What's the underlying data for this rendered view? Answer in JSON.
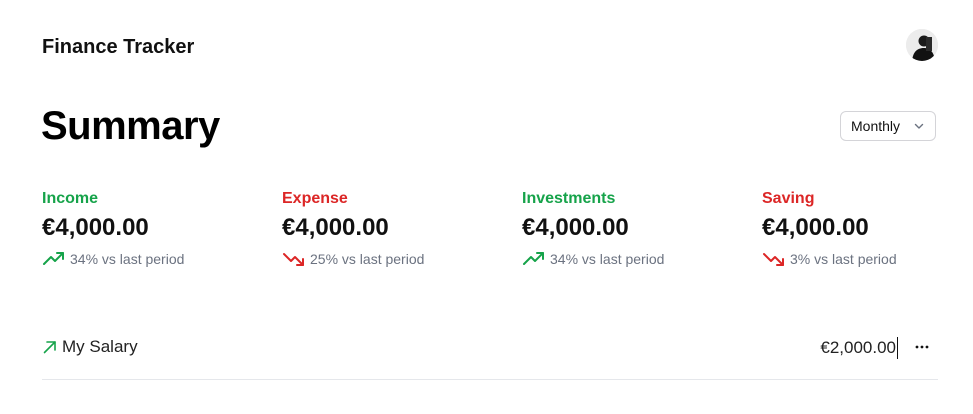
{
  "header": {
    "app_title": "Finance Tracker",
    "avatar_icon": "user-avatar"
  },
  "summary": {
    "title": "Summary",
    "period_select": {
      "selected": "Monthly",
      "icon": "chevron-down-icon"
    }
  },
  "stats": [
    {
      "label": "Income",
      "value": "€4,000.00",
      "change": "34% vs last period",
      "trend": "up",
      "color": "#16a34a"
    },
    {
      "label": "Expense",
      "value": "€4,000.00",
      "change": "25% vs last period",
      "trend": "down",
      "color": "#dc2626"
    },
    {
      "label": "Investments",
      "value": "€4,000.00",
      "change": "34% vs last period",
      "trend": "up",
      "color": "#16a34a"
    },
    {
      "label": "Saving",
      "value": "€4,000.00",
      "change": "3% vs last period",
      "trend": "down",
      "color": "#dc2626"
    }
  ],
  "transactions": [
    {
      "name": "My Salary",
      "amount": "€2,000.00",
      "icon": "arrow-up-right-icon",
      "menu_icon": "more-horizontal-icon"
    }
  ]
}
